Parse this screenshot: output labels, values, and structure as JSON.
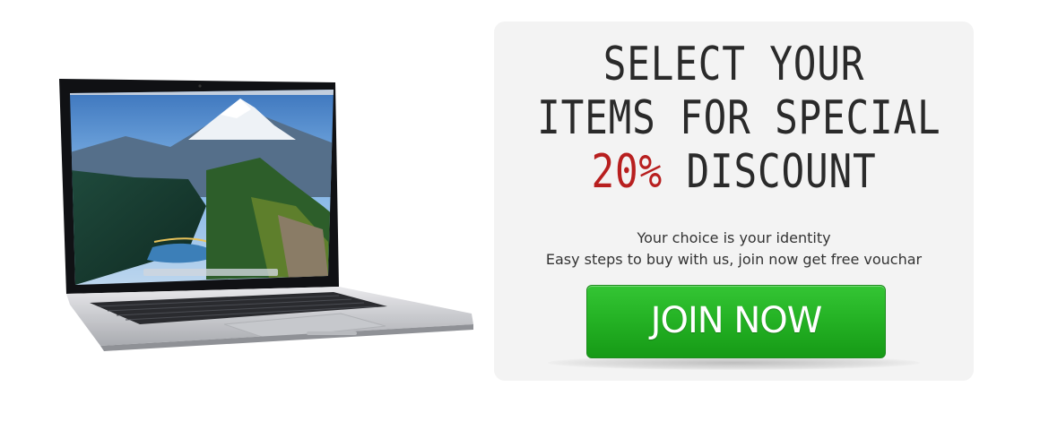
{
  "headline": {
    "line1": "SELECT YOUR",
    "line2": "ITEMS FOR SPECIAL",
    "highlight": "20%",
    "line3_rest": " DISCOUNT"
  },
  "subtext": {
    "line1": "Your choice is your identity",
    "line2": "Easy steps to buy with us, join now get free vouchar"
  },
  "cta": {
    "label": "JOIN NOW"
  },
  "colors": {
    "card_bg": "#f3f3f3",
    "highlight": "#b81f1f",
    "button": "#25b325"
  }
}
